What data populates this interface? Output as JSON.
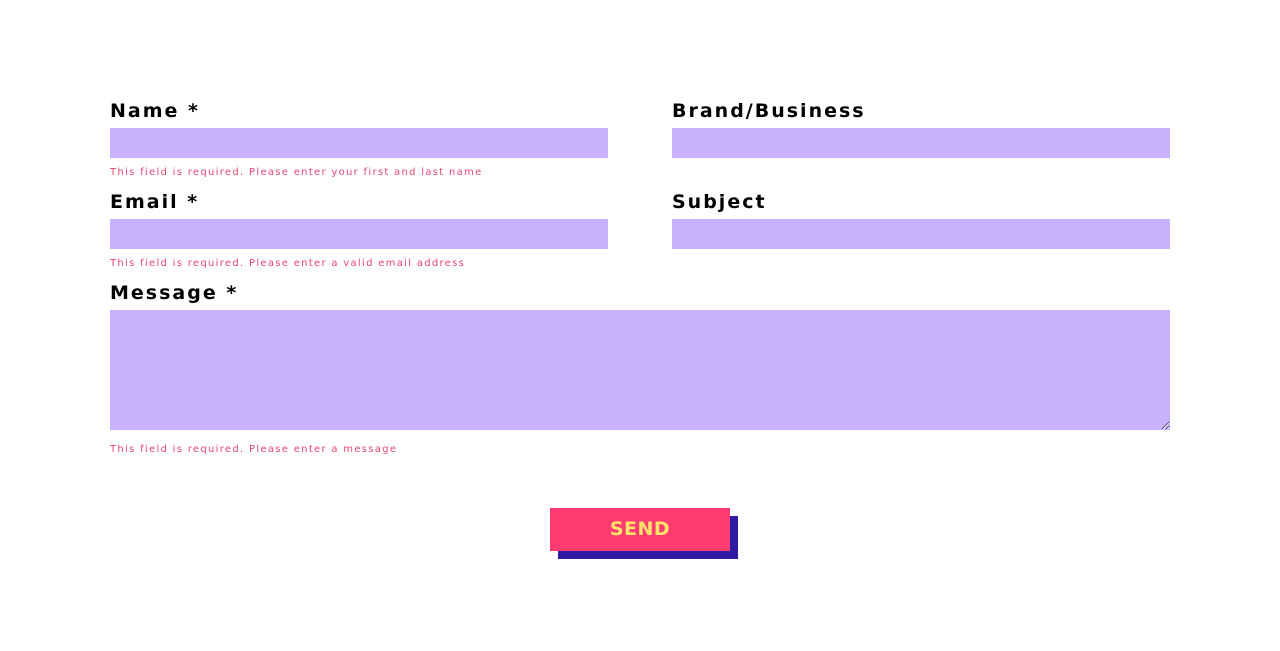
{
  "colors": {
    "field_background": "#c9b2fd",
    "error_text": "#e8476e",
    "button_background": "#fd3b70",
    "button_text": "#fee36b",
    "button_shadow": "#2f1aa5",
    "label_text": "#000000"
  },
  "form": {
    "name": {
      "label": "Name *",
      "value": "",
      "error": "This field is required. Please enter your first and last name"
    },
    "brand": {
      "label": "Brand/Business",
      "value": ""
    },
    "email": {
      "label": "Email *",
      "value": "",
      "error": "This field is required. Please enter a valid email address"
    },
    "subject": {
      "label": "Subject",
      "value": ""
    },
    "message": {
      "label": "Message *",
      "value": "",
      "error": "This field is required. Please enter a message"
    },
    "send_label": "SEND"
  }
}
